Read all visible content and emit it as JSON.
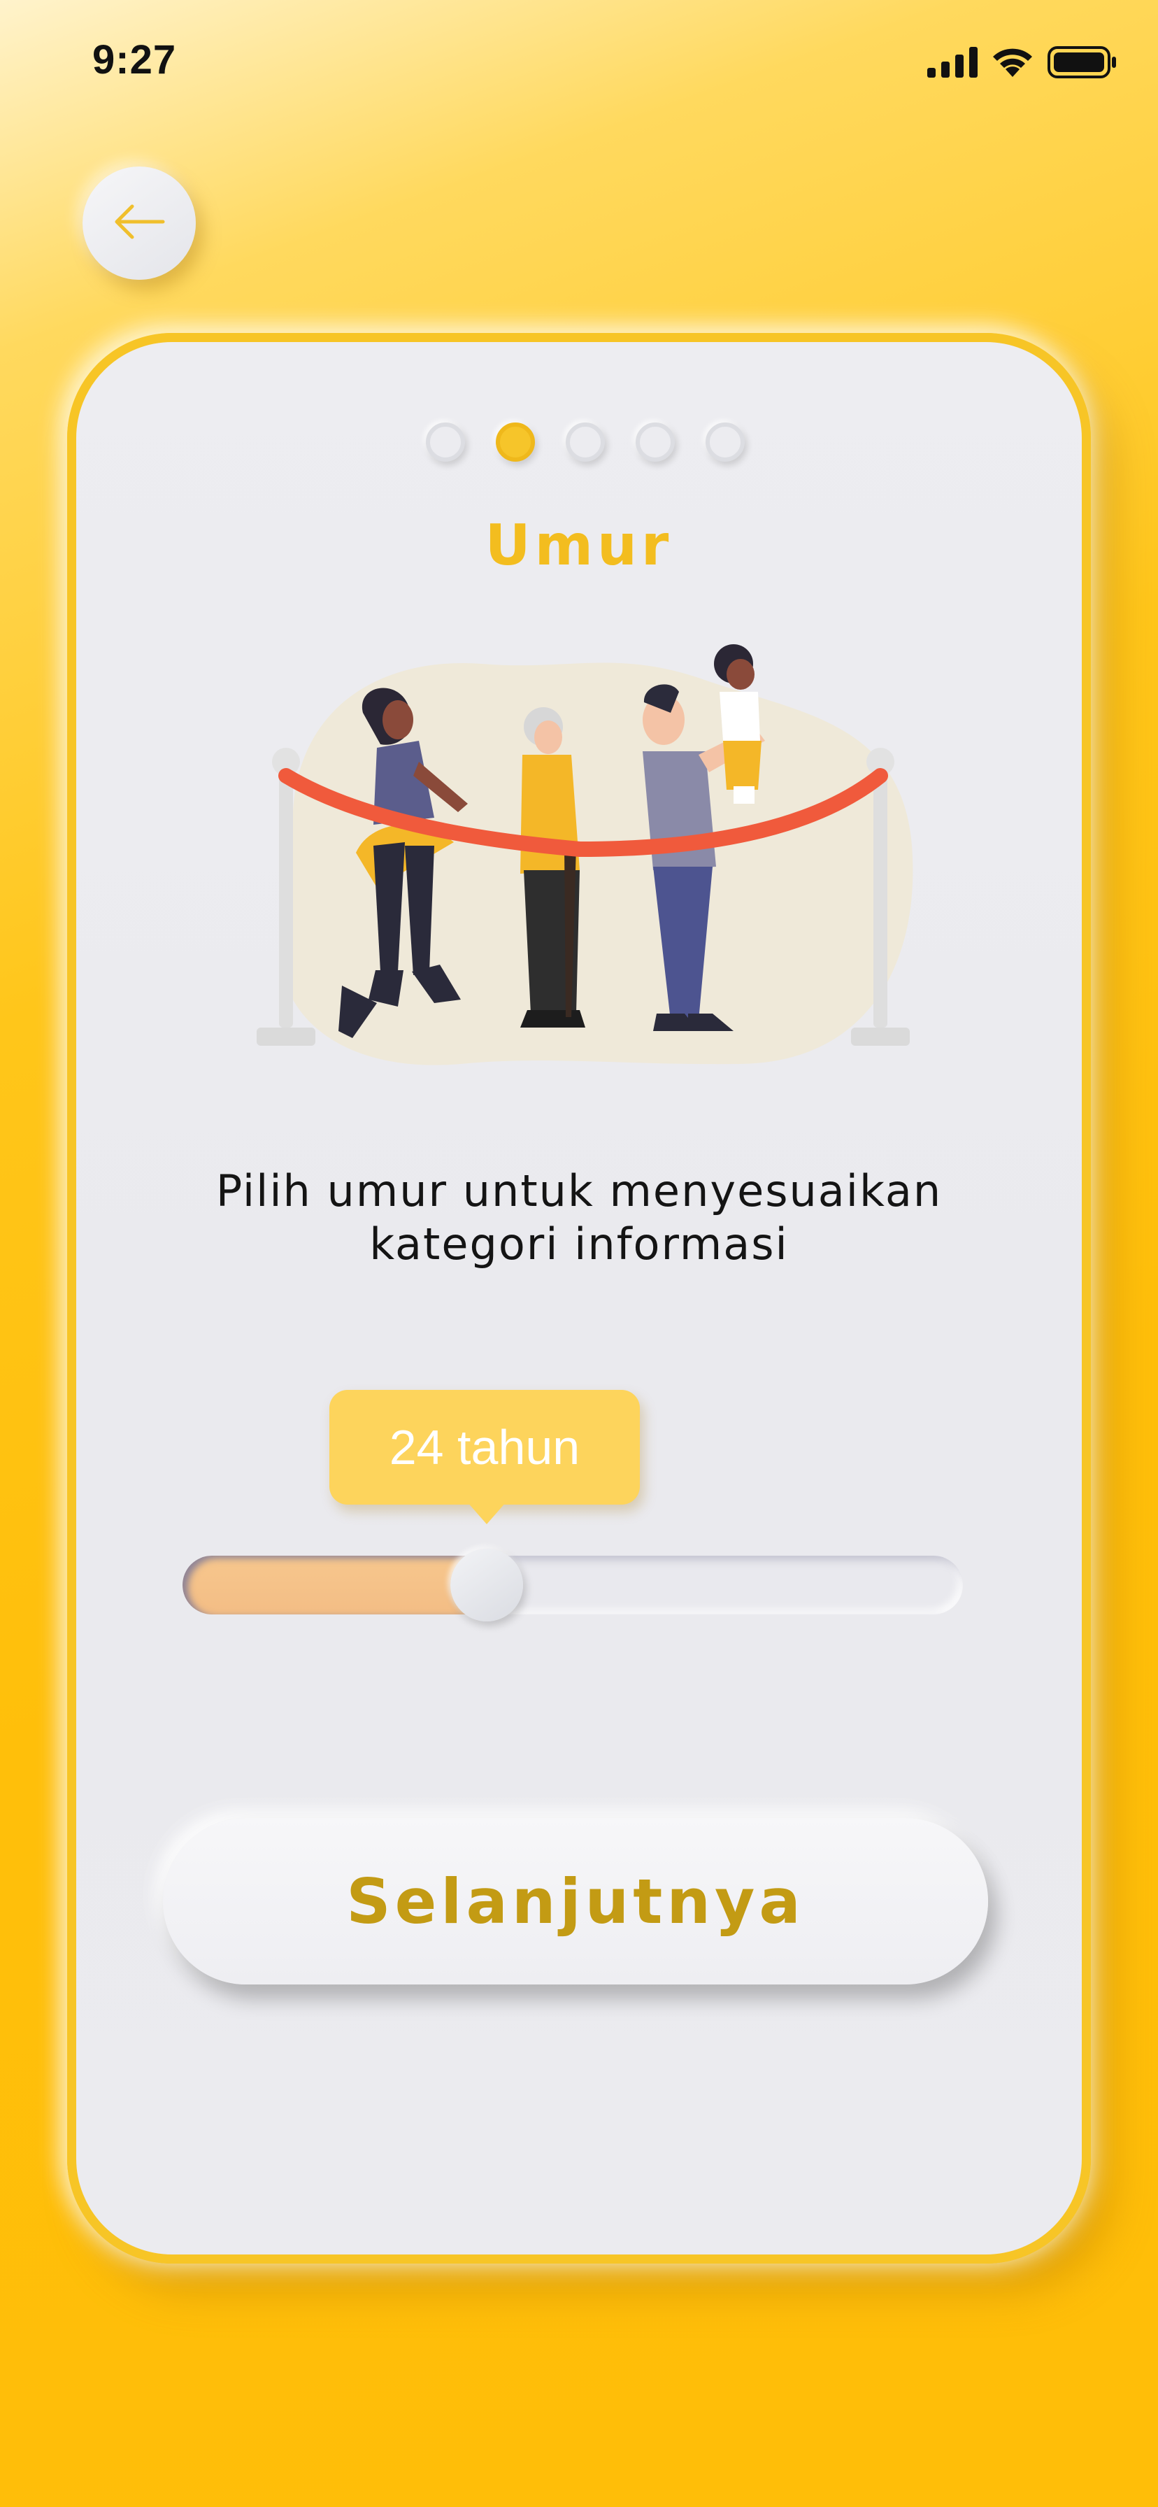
{
  "status_bar": {
    "time": "9:27",
    "icons": [
      "cellular-signal-icon",
      "wifi-icon",
      "battery-icon"
    ]
  },
  "header": {
    "back_icon": "arrow-left-icon"
  },
  "pager": {
    "total": 5,
    "active_index": 1
  },
  "screen": {
    "title": "Umur",
    "illustration": "people-of-different-ages-behind-rope-illustration",
    "description": "Pilih umur untuk menyesuaikan kategori informasi"
  },
  "slider": {
    "label": "24 tahun",
    "fill_fraction": 0.39
  },
  "actions": {
    "next_label": "Selanjutnya"
  },
  "colors": {
    "accent": "#f3bd1f",
    "background": "#ffbf0a",
    "card": "#ebebef",
    "button_text": "#c39b14",
    "tooltip": "#fdd45c",
    "rope": "#f05a3c"
  }
}
